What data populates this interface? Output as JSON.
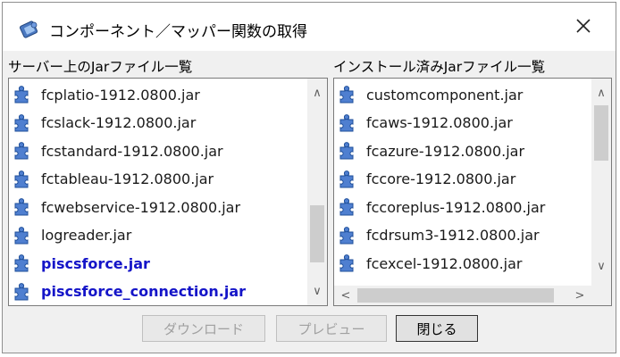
{
  "window": {
    "title": "コンポーネント／マッパー関数の取得",
    "close_glyph": "✕",
    "app_icon": "app-component-icon"
  },
  "server_panel": {
    "label": "サーバー上のJarファイル一覧",
    "items": [
      {
        "label": "fcplatio-1912.0800.jar",
        "highlight": false
      },
      {
        "label": "fcslack-1912.0800.jar",
        "highlight": false
      },
      {
        "label": "fcstandard-1912.0800.jar",
        "highlight": false
      },
      {
        "label": "fctableau-1912.0800.jar",
        "highlight": false
      },
      {
        "label": "fcwebservice-1912.0800.jar",
        "highlight": false
      },
      {
        "label": "logreader.jar",
        "highlight": false
      },
      {
        "label": "piscsforce.jar",
        "highlight": true
      },
      {
        "label": "piscsforce_connection.jar",
        "highlight": true
      }
    ],
    "item_icon": "puzzle-piece-icon",
    "scroll_up": "∧",
    "scroll_down": "∨",
    "highlight_color": "#1414c8"
  },
  "installed_panel": {
    "label": "インストール済みJarファイル一覧",
    "items": [
      {
        "label": "customcomponent.jar"
      },
      {
        "label": "fcaws-1912.0800.jar"
      },
      {
        "label": "fcazure-1912.0800.jar"
      },
      {
        "label": "fccore-1912.0800.jar"
      },
      {
        "label": "fccoreplus-1912.0800.jar"
      },
      {
        "label": "fcdrsum3-1912.0800.jar"
      },
      {
        "label": "fcexcel-1912.0800.jar"
      }
    ],
    "item_icon": "puzzle-piece-icon",
    "scroll_up": "∧",
    "scroll_down": "∨",
    "scroll_left": "<",
    "scroll_right": ">"
  },
  "buttons": {
    "download": "ダウンロード",
    "preview": "プレビュー",
    "close": "閉じる"
  }
}
